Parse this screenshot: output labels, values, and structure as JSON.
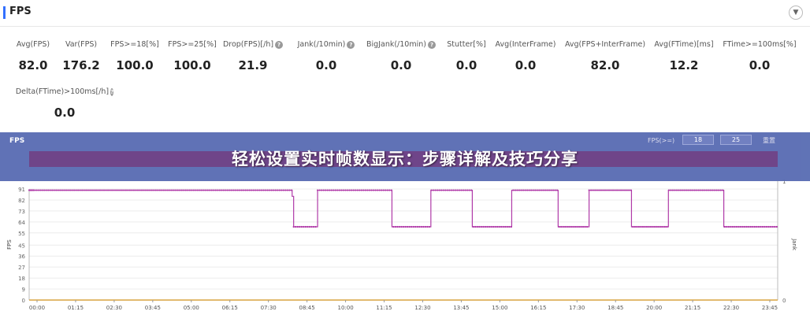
{
  "section": {
    "title": "FPS",
    "collapse_icon": "chevron-down-icon"
  },
  "metrics_row1": [
    {
      "label": "Avg(FPS)",
      "value": "82.0",
      "help": false
    },
    {
      "label": "Var(FPS)",
      "value": "176.2",
      "help": false
    },
    {
      "label": "FPS>=18[%]",
      "value": "100.0",
      "help": false
    },
    {
      "label": "FPS>=25[%]",
      "value": "100.0",
      "help": false
    },
    {
      "label": "Drop(FPS)[/h]",
      "value": "21.9",
      "help": true
    },
    {
      "label": "Jank(/10min)",
      "value": "0.0",
      "help": true
    },
    {
      "label": "BigJank(/10min)",
      "value": "0.0",
      "help": true
    },
    {
      "label": "Stutter[%]",
      "value": "0.0",
      "help": false
    },
    {
      "label": "Avg(InterFrame)",
      "value": "0.0",
      "help": false
    },
    {
      "label": "Avg(FPS+InterFrame)",
      "value": "82.0",
      "help": false
    },
    {
      "label": "Avg(FTime)[ms]",
      "value": "12.2",
      "help": false
    },
    {
      "label": "FTime>=100ms[%]",
      "value": "0.0",
      "help": false
    }
  ],
  "metrics_row2": [
    {
      "label": "Delta(FTime)>100ms[/h]",
      "value": "0.0",
      "help": true
    }
  ],
  "chart_panel": {
    "label": "FPS",
    "filter_label": "FPS(>=)",
    "filter_values": [
      "18",
      "25"
    ],
    "reset_label": "重置"
  },
  "headline": "轻松设置实时帧数显示：步骤详解及技巧分享",
  "colors": {
    "accent": "#3370ff",
    "fps_series": "#b03aa8",
    "banner": "#5b6eb4"
  },
  "chart_data": {
    "type": "line",
    "title": "",
    "ylabel": "FPS",
    "y2label": "Jank",
    "ylim": [
      0,
      91
    ],
    "y2lim": [
      0,
      1
    ],
    "yticks": [
      0,
      9,
      18,
      27,
      36,
      45,
      55,
      64,
      73,
      82,
      91
    ],
    "y2ticks": [
      0,
      1
    ],
    "xticks": [
      "00:00",
      "01:15",
      "02:30",
      "03:45",
      "05:00",
      "06:15",
      "07:30",
      "08:45",
      "10:00",
      "11:15",
      "12:30",
      "13:45",
      "15:00",
      "16:15",
      "17:30",
      "18:45",
      "20:00",
      "21:15",
      "22:30",
      "23:45"
    ],
    "xlim": [
      0,
      1500
    ],
    "series": [
      {
        "x": [
          0,
          2,
          4,
          6,
          8,
          10,
          14,
          18,
          22,
          26,
          30,
          34,
          38,
          42,
          46,
          50,
          54,
          58,
          62,
          66,
          70,
          74,
          78,
          82,
          86,
          90,
          94,
          98,
          102,
          106,
          110,
          114,
          118,
          122,
          126,
          130,
          134,
          138,
          142,
          146,
          150,
          154,
          158,
          162,
          166,
          170,
          174,
          178,
          182,
          186,
          190,
          194,
          198,
          202,
          206,
          210,
          214,
          218,
          222,
          226,
          230,
          234,
          238,
          242,
          246,
          250,
          254,
          258,
          262,
          266,
          270,
          274,
          278,
          282,
          286,
          290,
          294,
          298,
          302,
          306,
          310,
          314,
          318,
          322,
          326,
          330,
          334,
          338,
          342,
          346,
          350,
          354,
          358,
          362,
          366,
          370,
          374,
          378,
          382,
          386,
          390,
          394,
          398,
          402,
          406,
          410,
          414,
          418,
          422,
          426,
          430,
          434,
          438,
          442,
          446,
          450,
          454,
          458,
          462,
          466,
          470,
          474,
          478,
          482,
          486,
          490,
          494,
          498,
          502,
          506,
          510,
          514,
          518,
          522,
          526,
          530,
          534,
          538,
          542,
          546,
          550,
          554,
          558,
          562,
          566,
          570,
          574,
          578,
          582,
          586,
          590,
          594,
          598,
          602,
          606,
          610,
          614,
          618,
          622,
          626,
          630,
          634,
          638,
          642,
          646,
          650,
          654,
          658,
          662,
          666,
          670,
          674,
          678,
          682,
          686,
          690,
          694,
          698,
          702,
          706,
          710,
          714,
          718,
          722,
          726,
          730,
          734,
          738,
          742,
          746,
          750,
          754,
          758,
          762,
          766,
          770,
          774,
          778,
          782,
          786,
          790,
          794,
          798,
          802,
          806,
          810,
          814,
          818,
          822,
          826,
          830,
          834,
          838,
          842,
          846,
          850,
          854,
          858,
          862,
          866,
          870,
          874,
          878,
          882,
          886,
          890,
          894,
          898,
          902,
          906,
          910,
          914,
          918,
          922,
          926,
          930,
          934,
          938,
          942,
          946,
          950,
          954,
          958,
          962,
          966,
          970,
          974,
          978,
          982,
          986,
          990,
          994,
          998,
          1002,
          1006,
          1010,
          1014,
          1018,
          1022,
          1026,
          1030,
          1034,
          1038,
          1042,
          1046,
          1050,
          1054,
          1058,
          1062,
          1066,
          1070,
          1074,
          1078,
          1082,
          1086,
          1090,
          1094,
          1098,
          1102,
          1106,
          1110,
          1114,
          1118,
          1122,
          1126,
          1130,
          1134,
          1138,
          1142,
          1146,
          1150,
          1154,
          1158,
          1162,
          1166,
          1170,
          1174,
          1178,
          1182,
          1186,
          1190,
          1194,
          1198,
          1202,
          1206,
          1210,
          1214,
          1218,
          1222,
          1226,
          1230,
          1234,
          1238,
          1242,
          1246,
          1250,
          1254,
          1258,
          1262,
          1266,
          1270,
          1274,
          1278,
          1282,
          1286,
          1290,
          1294,
          1298,
          1302,
          1306,
          1310,
          1314,
          1318,
          1322,
          1326,
          1330,
          1334,
          1338,
          1342,
          1346,
          1350,
          1354,
          1358,
          1362,
          1366,
          1370,
          1374,
          1378,
          1382,
          1386,
          1390,
          1394,
          1398,
          1402,
          1406,
          1410,
          1414,
          1418,
          1422,
          1426,
          1430,
          1434,
          1438,
          1442,
          1446,
          1450,
          1454,
          1458,
          1462,
          1466,
          1470,
          1474,
          1478,
          1482,
          1486,
          1490,
          1494,
          1498
        ],
        "segments": [
          {
            "from": 0,
            "to": 527,
            "level": 90
          },
          {
            "from": 527,
            "to": 530,
            "level": 85
          },
          {
            "from": 530,
            "to": 578,
            "level": 60
          },
          {
            "from": 578,
            "to": 727,
            "level": 90
          },
          {
            "from": 727,
            "to": 805,
            "level": 60
          },
          {
            "from": 805,
            "to": 888,
            "level": 90
          },
          {
            "from": 888,
            "to": 967,
            "level": 60
          },
          {
            "from": 967,
            "to": 1060,
            "level": 90
          },
          {
            "from": 1060,
            "to": 1122,
            "level": 60
          },
          {
            "from": 1122,
            "to": 1207,
            "level": 90
          },
          {
            "from": 1207,
            "to": 1281,
            "level": 60
          },
          {
            "from": 1281,
            "to": 1392,
            "level": 90
          },
          {
            "from": 1392,
            "to": 1500,
            "level": 60
          }
        ]
      }
    ],
    "grid": true,
    "legend": "none"
  }
}
